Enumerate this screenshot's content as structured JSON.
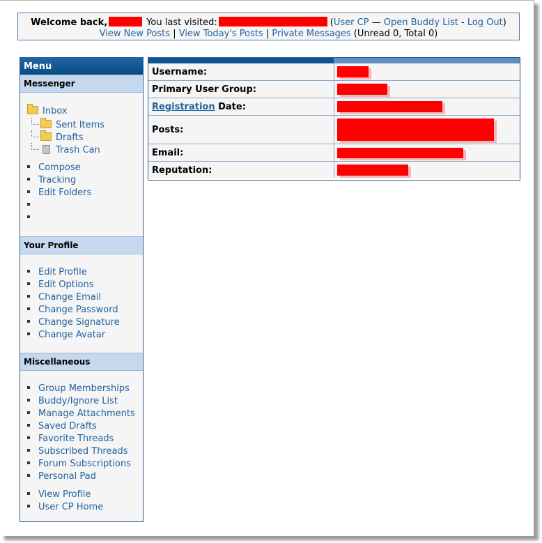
{
  "welcome": {
    "prefix": "Welcome back,",
    "visited": "You last visited:",
    "user_cp": "User CP",
    "dash": "—",
    "buddy": "Open Buddy List",
    "hyphen": "-",
    "logout": "Log Out",
    "new_posts": "View New Posts",
    "todays_posts": "View Today's Posts",
    "pm": "Private Messages",
    "pm_counts": "(Unread 0, Total 0)"
  },
  "sidebar": {
    "menu_title": "Menu",
    "messenger_title": "Messenger",
    "folders": [
      "Inbox",
      "Sent Items",
      "Drafts",
      "Trash Can"
    ],
    "messenger_links": [
      "Compose",
      "Tracking",
      "Edit Folders",
      "",
      ""
    ],
    "profile_title": "Your Profile",
    "profile_links": [
      "Edit Profile",
      "Edit Options",
      "Change Email",
      "Change Password",
      "Change Signature",
      "Change Avatar"
    ],
    "misc_title": "Miscellaneous",
    "misc_links": [
      "Group Memberships",
      "Buddy/Ignore List",
      "Manage Attachments",
      "Saved Drafts",
      "Favorite Threads",
      "Subscribed Threads",
      "Forum Subscriptions",
      "Personal Pad"
    ],
    "extra_links": [
      "View Profile",
      "User CP Home"
    ]
  },
  "profile": {
    "username": "Username:",
    "group": "Primary User Group:",
    "registration_link": "Registration",
    "registration_rest": " Date:",
    "posts": "Posts:",
    "email": "Email:",
    "reputation": "Reputation:"
  },
  "colors": {
    "accent": "#22629e",
    "header_blue": "#0f5591",
    "section_blue": "#c5d8ee",
    "redaction": "#ff0000"
  }
}
